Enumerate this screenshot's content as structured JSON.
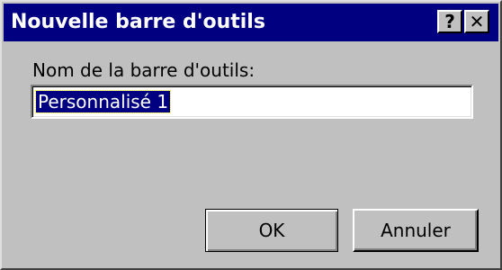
{
  "window": {
    "title": "Nouvelle barre d'outils",
    "help_label": "?",
    "close_label": "✕"
  },
  "form": {
    "label": "Nom de la barre d'outils:",
    "value": "Personnalisé 1"
  },
  "buttons": {
    "ok": "OK",
    "cancel": "Annuler"
  },
  "colors": {
    "title_bar": "#000080",
    "dialog_face": "#c0c0c0",
    "selection": "#000080"
  }
}
